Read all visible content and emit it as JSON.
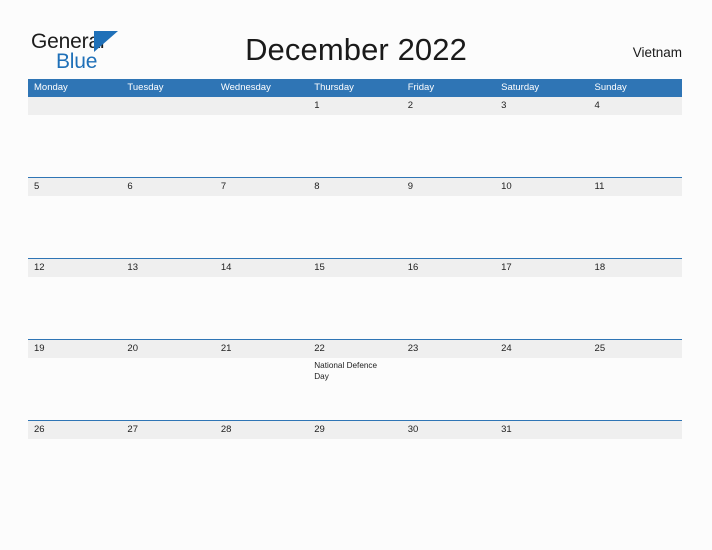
{
  "header": {
    "logo": {
      "line1": "General",
      "line2": "Blue",
      "triangle_icon": "triangle-icon"
    },
    "title": "December 2022",
    "region": "Vietnam"
  },
  "colors": {
    "header_blue": "#2f75b5",
    "row_divider_blue": "#2f75b5",
    "date_strip_gray": "#efefef",
    "brand_blue": "#1f70b8",
    "page_background": "#fcfcfc",
    "text_dark": "#222222",
    "weekday_text": "#ffffff"
  },
  "calendar": {
    "weekdays": [
      "Monday",
      "Tuesday",
      "Wednesday",
      "Thursday",
      "Friday",
      "Saturday",
      "Sunday"
    ],
    "weeks": [
      [
        {
          "date": "",
          "event": ""
        },
        {
          "date": "",
          "event": ""
        },
        {
          "date": "",
          "event": ""
        },
        {
          "date": "1",
          "event": ""
        },
        {
          "date": "2",
          "event": ""
        },
        {
          "date": "3",
          "event": ""
        },
        {
          "date": "4",
          "event": ""
        }
      ],
      [
        {
          "date": "5",
          "event": ""
        },
        {
          "date": "6",
          "event": ""
        },
        {
          "date": "7",
          "event": ""
        },
        {
          "date": "8",
          "event": ""
        },
        {
          "date": "9",
          "event": ""
        },
        {
          "date": "10",
          "event": ""
        },
        {
          "date": "11",
          "event": ""
        }
      ],
      [
        {
          "date": "12",
          "event": ""
        },
        {
          "date": "13",
          "event": ""
        },
        {
          "date": "14",
          "event": ""
        },
        {
          "date": "15",
          "event": ""
        },
        {
          "date": "16",
          "event": ""
        },
        {
          "date": "17",
          "event": ""
        },
        {
          "date": "18",
          "event": ""
        }
      ],
      [
        {
          "date": "19",
          "event": ""
        },
        {
          "date": "20",
          "event": ""
        },
        {
          "date": "21",
          "event": ""
        },
        {
          "date": "22",
          "event": "National Defence Day"
        },
        {
          "date": "23",
          "event": ""
        },
        {
          "date": "24",
          "event": ""
        },
        {
          "date": "25",
          "event": ""
        }
      ],
      [
        {
          "date": "26",
          "event": ""
        },
        {
          "date": "27",
          "event": ""
        },
        {
          "date": "28",
          "event": ""
        },
        {
          "date": "29",
          "event": ""
        },
        {
          "date": "30",
          "event": ""
        },
        {
          "date": "31",
          "event": ""
        },
        {
          "date": "",
          "event": ""
        }
      ]
    ]
  }
}
